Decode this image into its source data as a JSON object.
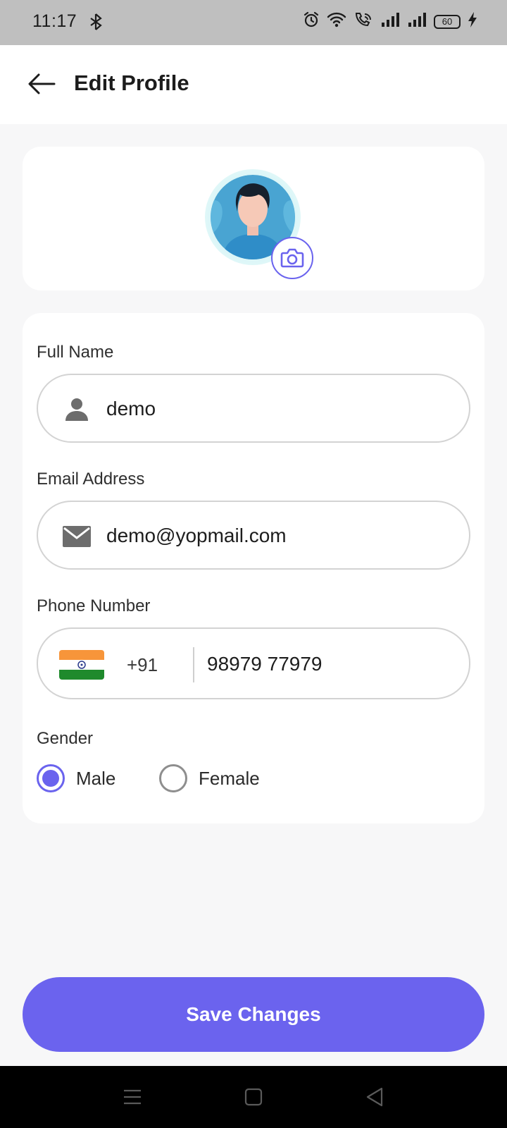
{
  "status_bar": {
    "time": "11:17",
    "battery": "60"
  },
  "header": {
    "title": "Edit Profile"
  },
  "form": {
    "full_name_label": "Full Name",
    "full_name_value": "demo",
    "email_label": "Email Address",
    "email_value": "demo@yopmail.com",
    "phone_label": "Phone Number",
    "country_code": "+91",
    "phone_value": "98979 77979",
    "gender_label": "Gender",
    "gender_options": [
      {
        "label": "Male",
        "selected": true
      },
      {
        "label": "Female",
        "selected": false
      }
    ]
  },
  "actions": {
    "save_label": "Save Changes"
  },
  "icons": {
    "back": "arrow-left-icon",
    "camera": "camera-icon",
    "person": "person-icon",
    "mail": "mail-icon",
    "flag": "india-flag-icon"
  },
  "colors": {
    "accent": "#6b63ee",
    "background": "#f7f7f8",
    "card": "#ffffff",
    "status_bar": "#bfbfbf"
  }
}
